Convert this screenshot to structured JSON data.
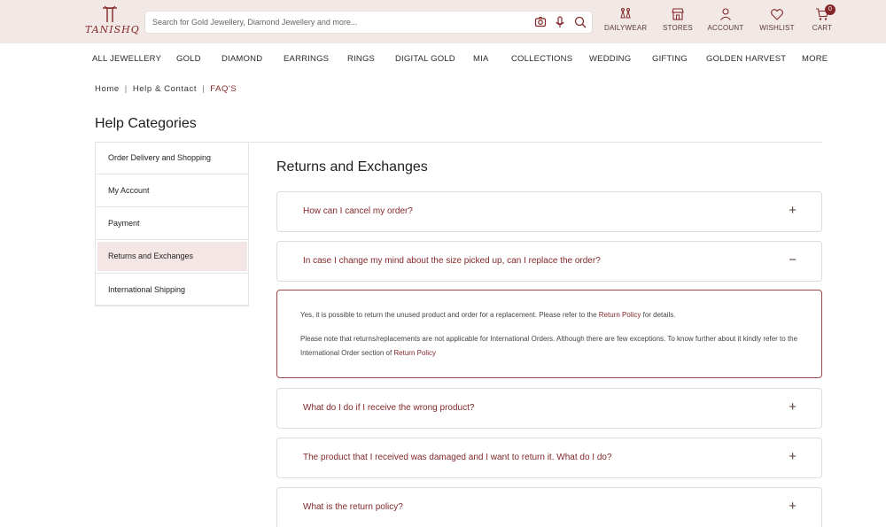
{
  "header": {
    "logo_text": "TANISHQ",
    "search_placeholder": "Search for Gold Jewellery, Diamond Jewellery and more...",
    "nav": [
      {
        "label": "DAILYWEAR",
        "icon": "earring-icon"
      },
      {
        "label": "STORES",
        "icon": "store-icon"
      },
      {
        "label": "ACCOUNT",
        "icon": "user-icon"
      },
      {
        "label": "WISHLIST",
        "icon": "heart-icon"
      },
      {
        "label": "CART",
        "icon": "cart-icon"
      }
    ],
    "cart_count": "0"
  },
  "categories": [
    "ALL JEWELLERY",
    "GOLD",
    "DIAMOND",
    "EARRINGS",
    "RINGS",
    "DIGITAL GOLD",
    "MIA",
    "COLLECTIONS",
    "WEDDING",
    "GIFTING",
    "GOLDEN HARVEST",
    "MORE"
  ],
  "breadcrumb": {
    "home": "Home",
    "help": "Help & Contact",
    "current": "FAQ'S"
  },
  "help_title": "Help Categories",
  "sidebar": {
    "items": [
      "Order Delivery and Shopping",
      "My Account",
      "Payment",
      "Returns and Exchanges",
      "International Shipping"
    ],
    "active_index": 3
  },
  "main": {
    "title": "Returns and Exchanges",
    "faqs": [
      {
        "question": "How can I cancel my order?",
        "toggle": "+"
      },
      {
        "question": "In case I change my mind about the size picked up, can I replace the order?",
        "toggle": "−"
      },
      {
        "question": "What do I do if I receive the wrong product?",
        "toggle": "+"
      },
      {
        "question": "The product that I received was damaged and I want to return it. What do I do?",
        "toggle": "+"
      },
      {
        "question": "What is the return policy?",
        "toggle": "+"
      }
    ],
    "answer": {
      "p1_text": "Yes, it is possible to return the unused product and order for a replacement. Please refer to the ",
      "p1_link": "Return Policy",
      "p1_end": " for details.",
      "p2_text": "Please note that returns/replacements are not applicable for International Orders. Although there are few exceptions. To know further about it kindly refer to the International Order section of ",
      "p2_link": "Return Policy"
    }
  },
  "colors": {
    "brand": "#832729",
    "header_bg": "#f2e9e6",
    "active_bg": "#f3e6e4"
  }
}
